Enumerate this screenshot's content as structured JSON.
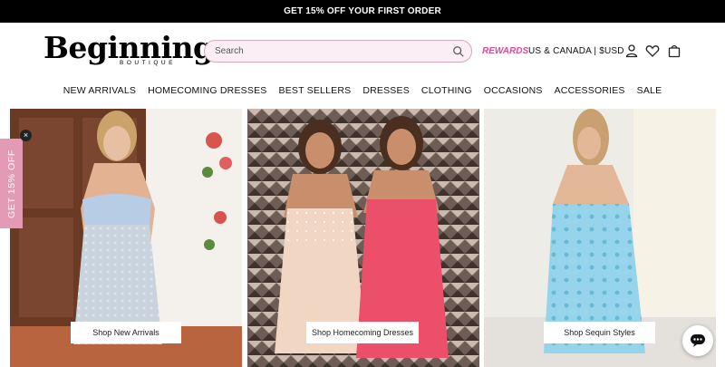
{
  "announcement": {
    "text": "GET 15% OFF YOUR FIRST ORDER"
  },
  "header": {
    "logo_text": "Beginning",
    "logo_subtext": "BOUTIQUE",
    "search": {
      "placeholder": "Search",
      "value": ""
    },
    "rewards_label": "REWARDS",
    "region_label": "US & CANADA | $USD",
    "icons": [
      "search-icon",
      "user-icon",
      "heart-icon",
      "cart-icon"
    ]
  },
  "nav": {
    "items": [
      {
        "label": "NEW ARRIVALS"
      },
      {
        "label": "HOMECOMING DRESSES"
      },
      {
        "label": "BEST SELLERS"
      },
      {
        "label": "DRESSES"
      },
      {
        "label": "CLOTHING"
      },
      {
        "label": "OCCASIONS"
      },
      {
        "label": "ACCESSORIES"
      },
      {
        "label": "SALE"
      }
    ]
  },
  "hero": {
    "panels": [
      {
        "cta_label": "Shop New Arrivals"
      },
      {
        "cta_label": "Shop Homecoming Dresses"
      },
      {
        "cta_label": "Shop Sequin Styles"
      }
    ]
  },
  "promo_tab": {
    "label": "GET 15% OFF",
    "close_glyph": "×"
  },
  "colors": {
    "accent_pink": "#e1489a",
    "promo_pink": "#e39ab4",
    "search_bg": "#fbeff5"
  }
}
